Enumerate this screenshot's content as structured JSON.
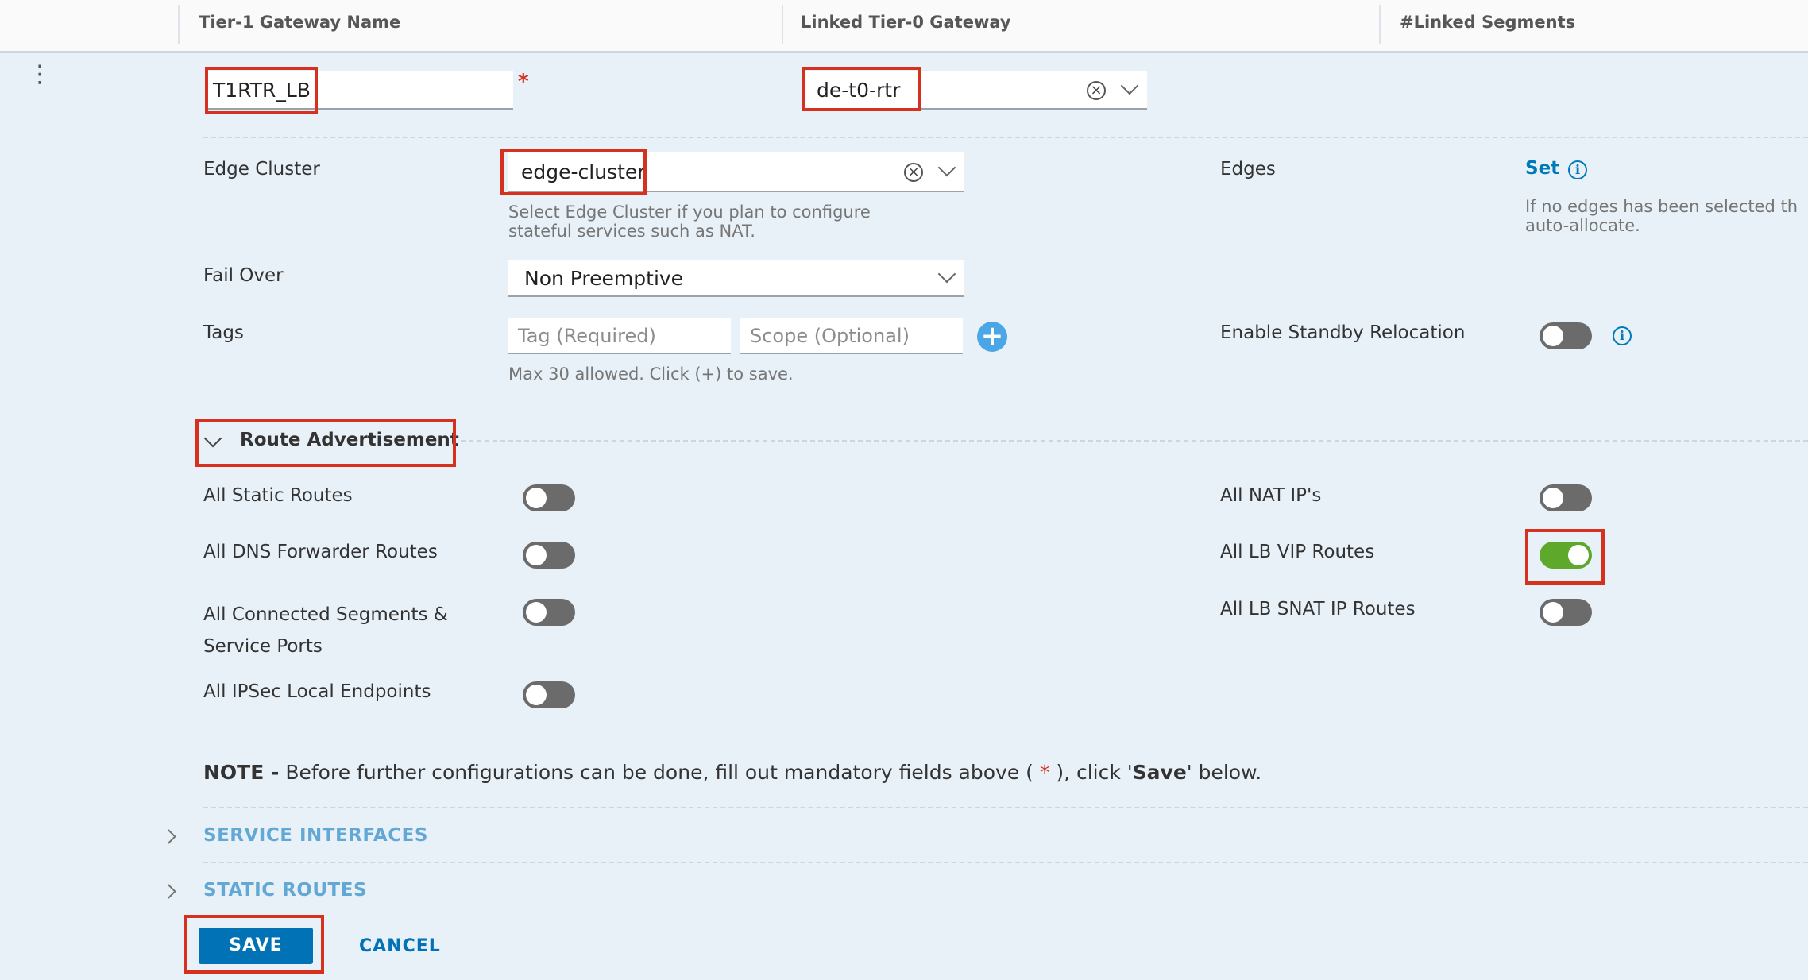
{
  "columns": [
    "Tier-1 Gateway Name",
    "Linked Tier-0 Gateway",
    "#Linked Segments"
  ],
  "gateway_name": {
    "value": "T1RTR_LB",
    "required_mark": "*"
  },
  "linked_t0": {
    "value": "de-t0-rtr"
  },
  "edge_cluster": {
    "label": "Edge Cluster",
    "value": "edge-cluster",
    "help_line1": "Select Edge Cluster if you plan to configure",
    "help_line2": "stateful services such as NAT."
  },
  "edges": {
    "label": "Edges",
    "link": "Set",
    "help_line1": "If no edges has been selected th",
    "help_line2": "auto-allocate."
  },
  "fail_over": {
    "label": "Fail Over",
    "value": "Non Preemptive"
  },
  "tags": {
    "label": "Tags",
    "tag_placeholder": "Tag (Required)",
    "scope_placeholder": "Scope (Optional)",
    "help": "Max 30 allowed. Click (+) to save."
  },
  "standby_relocation": {
    "label": "Enable Standby Relocation",
    "enabled": false
  },
  "route_advertisement": {
    "title": "Route Advertisement",
    "left": [
      {
        "label": "All Static Routes",
        "enabled": false
      },
      {
        "label": "All DNS Forwarder Routes",
        "enabled": false
      },
      {
        "label_line1": "All Connected Segments &",
        "label_line2": "Service Ports",
        "enabled": false
      },
      {
        "label": "All IPSec Local Endpoints",
        "enabled": false
      }
    ],
    "right": [
      {
        "label": "All NAT IP's",
        "enabled": false
      },
      {
        "label": "All LB VIP Routes",
        "enabled": true
      },
      {
        "label": "All LB SNAT IP Routes",
        "enabled": false
      }
    ]
  },
  "note": {
    "prefix": "NOTE -",
    "text1": " Before further configurations can be done, fill out mandatory fields above ( ",
    "star": "*",
    "text2": " ), click '",
    "save_word": "Save",
    "text3": "' below."
  },
  "sections": [
    "SERVICE INTERFACES",
    "STATIC ROUTES"
  ],
  "buttons": {
    "save": "SAVE",
    "cancel": "CANCEL"
  },
  "colors": {
    "highlight": "#d6301e",
    "primary": "#0072b5",
    "toggle_on": "#5ea82b"
  }
}
